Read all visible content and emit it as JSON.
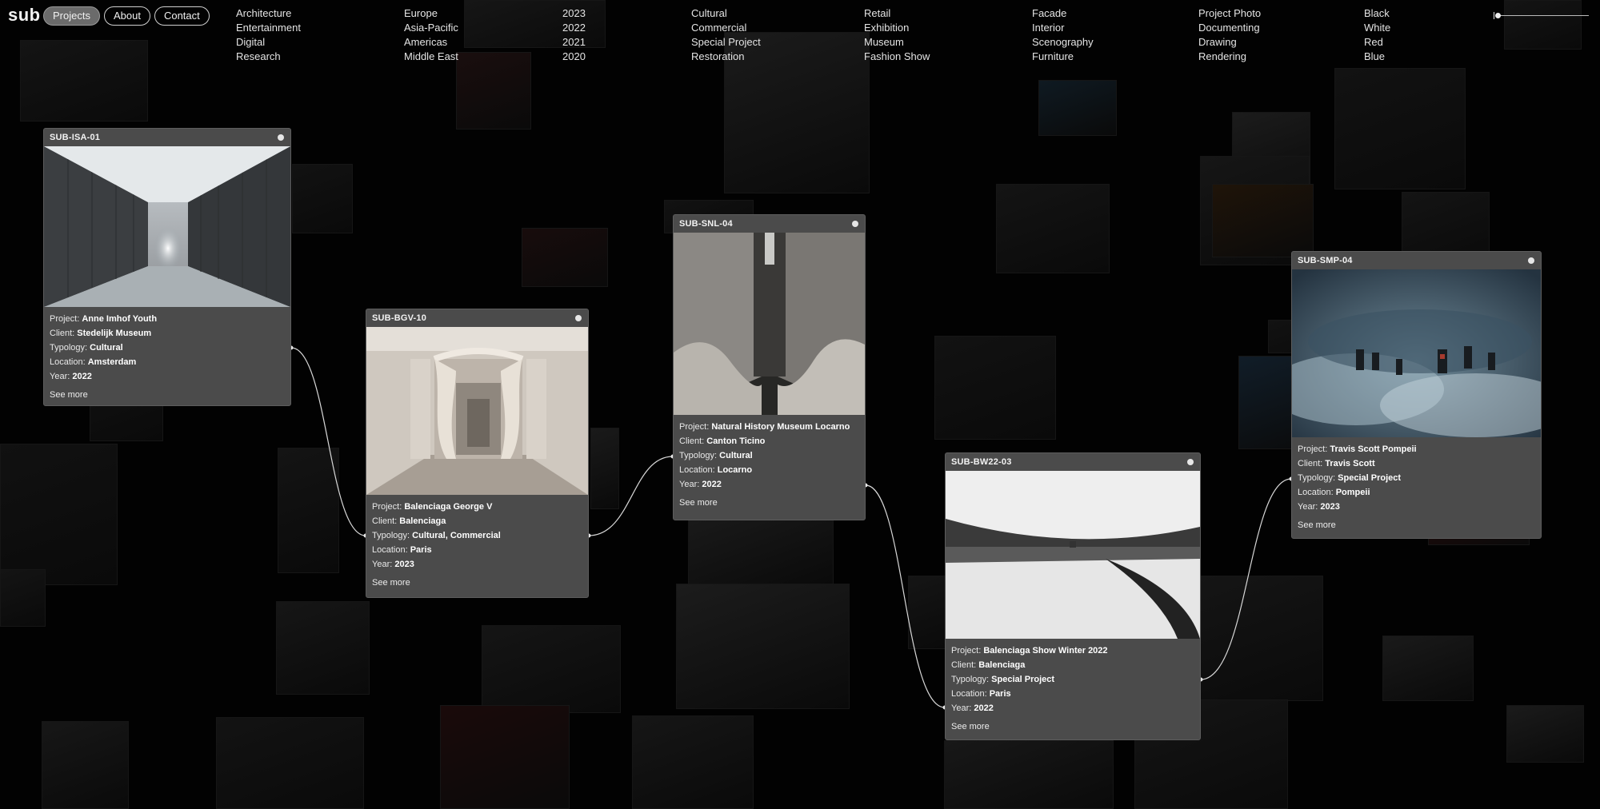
{
  "app": {
    "logo": "sub"
  },
  "nav": [
    {
      "label": "Projects",
      "active": true
    },
    {
      "label": "About",
      "active": false
    },
    {
      "label": "Contact",
      "active": false
    }
  ],
  "filters": [
    [
      "Architecture",
      "Entertainment",
      "Digital",
      "Research"
    ],
    [
      "Europe",
      "Asia-Pacific",
      "Americas",
      "Middle East"
    ],
    [
      "2023",
      "2022",
      "2021",
      "2020"
    ],
    [
      "Cultural",
      "Commercial",
      "Special Project",
      "Restoration"
    ],
    [
      "Retail",
      "Exhibition",
      "Museum",
      "Fashion Show"
    ],
    [
      "Facade",
      "Interior",
      "Scenography",
      "Furniture"
    ],
    [
      "Project Photo",
      "Documenting",
      "Drawing",
      "Rendering"
    ],
    [
      "Black",
      "White",
      "Red",
      "Blue"
    ]
  ],
  "labels": {
    "project": "Project:",
    "client": "Client:",
    "typology": "Typology:",
    "location": "Location:",
    "year": "Year:",
    "see_more": "See more"
  },
  "cards": [
    {
      "code": "SUB-ISA-01",
      "project": "Anne Imhof Youth",
      "client": "Stedelijk Museum",
      "typology": "Cultural",
      "location": "Amsterdam",
      "year": "2022"
    },
    {
      "code": "SUB-BGV-10",
      "project": "Balenciaga George V",
      "client": "Balenciaga",
      "typology": "Cultural, Commercial",
      "location": "Paris",
      "year": "2023"
    },
    {
      "code": "SUB-SNL-04",
      "project": "Natural History Museum Locarno",
      "client": "Canton Ticino",
      "typology": "Cultural",
      "location": "Locarno",
      "year": "2022"
    },
    {
      "code": "SUB-BW22-03",
      "project": "Balenciaga Show Winter 2022",
      "client": "Balenciaga",
      "typology": "Special Project",
      "location": "Paris",
      "year": "2022"
    },
    {
      "code": "SUB-SMP-04",
      "project": "Travis Scott Pompeii",
      "client": "Travis Scott",
      "typology": "Special Project",
      "location": "Pompeii",
      "year": "2023"
    }
  ],
  "colors": {
    "background": "#020202",
    "card": "#4b4b4b",
    "wire": "#d8d8d8"
  },
  "icons": {
    "card_marker": "dot-icon",
    "slider": "slider-icon"
  }
}
